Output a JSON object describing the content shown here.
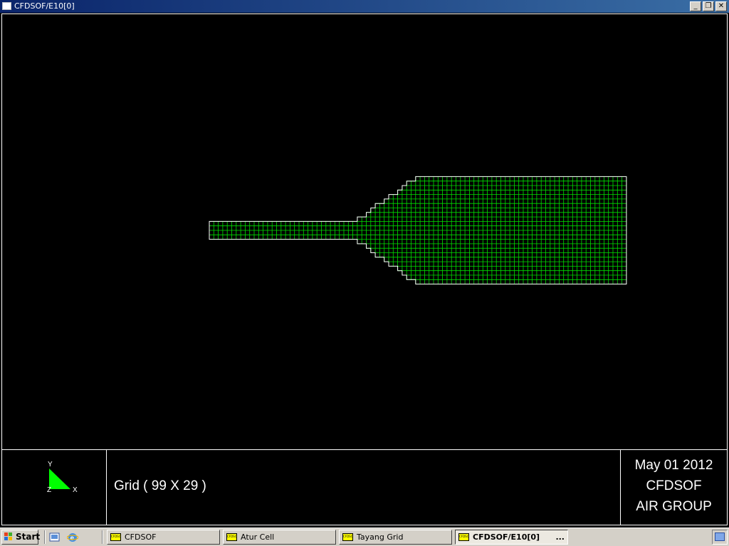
{
  "window": {
    "title": "CFDSOF/E10[0]",
    "buttons": {
      "minimize": "_",
      "restore": "❐",
      "close": "✕"
    }
  },
  "mesh": {
    "cell_color": "#00e000",
    "outline_color": "#ffffff",
    "background": "#000000"
  },
  "axis": {
    "y_label": "Y",
    "x_label": "X",
    "z_label": "Z",
    "triangle_color": "#00ff00"
  },
  "info": {
    "grid_text": "Grid ( 99 X 29 )",
    "date": "May 01 2012",
    "app": "CFDSOF",
    "group": "AIR GROUP"
  },
  "taskbar": {
    "start_label": "Start",
    "tasks": [
      {
        "label": "CFDSOF",
        "icon_text": "CFDSOF",
        "active": false
      },
      {
        "label": "Atur Cell",
        "icon_text": "CFDSOF",
        "active": false
      },
      {
        "label": "Tayang Grid",
        "icon_text": "CFDSOF",
        "active": false
      },
      {
        "label": "CFDSOF/E10[0]",
        "icon_text": "CFDSOF",
        "active": true,
        "more": "..."
      }
    ]
  }
}
